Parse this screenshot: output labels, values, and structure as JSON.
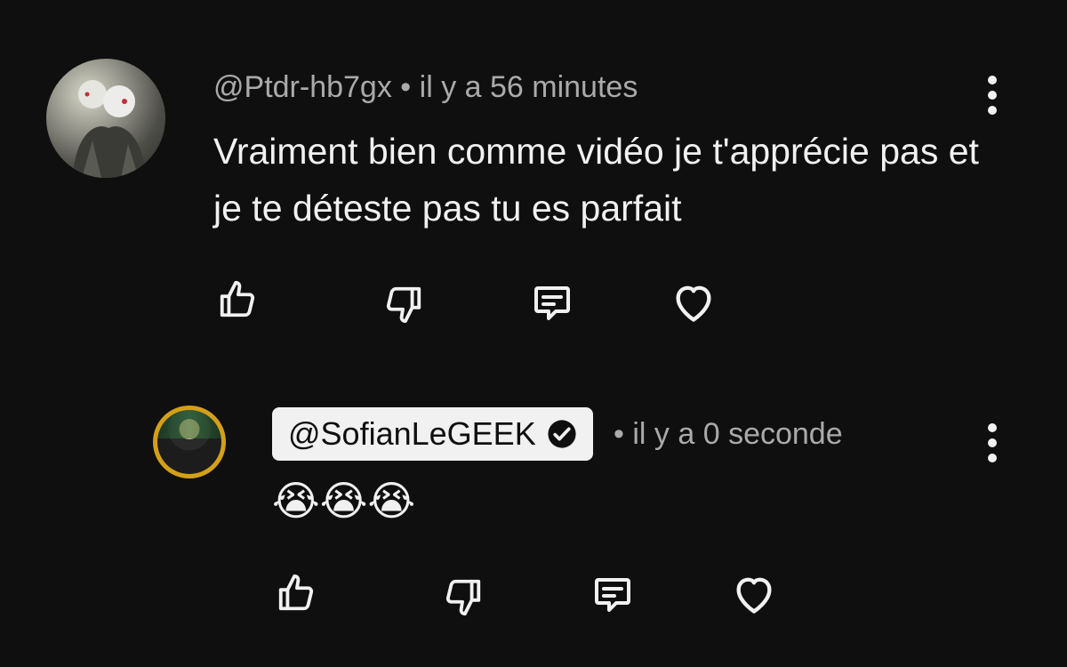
{
  "comments": [
    {
      "author": "@Ptdr-hb7gx",
      "separator": "•",
      "time": "il y a 56 minutes",
      "text": "Vraiment bien comme vidéo je t'apprécie pas et je te déteste pas tu es parfait",
      "avatar_icon": "anime-avatar"
    }
  ],
  "reply": {
    "author": "@SofianLeGEEK",
    "verified_icon": "check-circle-icon",
    "separator": "•",
    "time": "il y a 0 seconde",
    "text": "😭😭😭",
    "avatar_icon": "profile-photo"
  },
  "actions": [
    "like",
    "dislike",
    "reply",
    "heart"
  ],
  "colors": {
    "background": "#0f0f0f",
    "text": "#f1f1f1",
    "meta": "#aaaaaa",
    "avatar_ring": "#d4a017"
  }
}
